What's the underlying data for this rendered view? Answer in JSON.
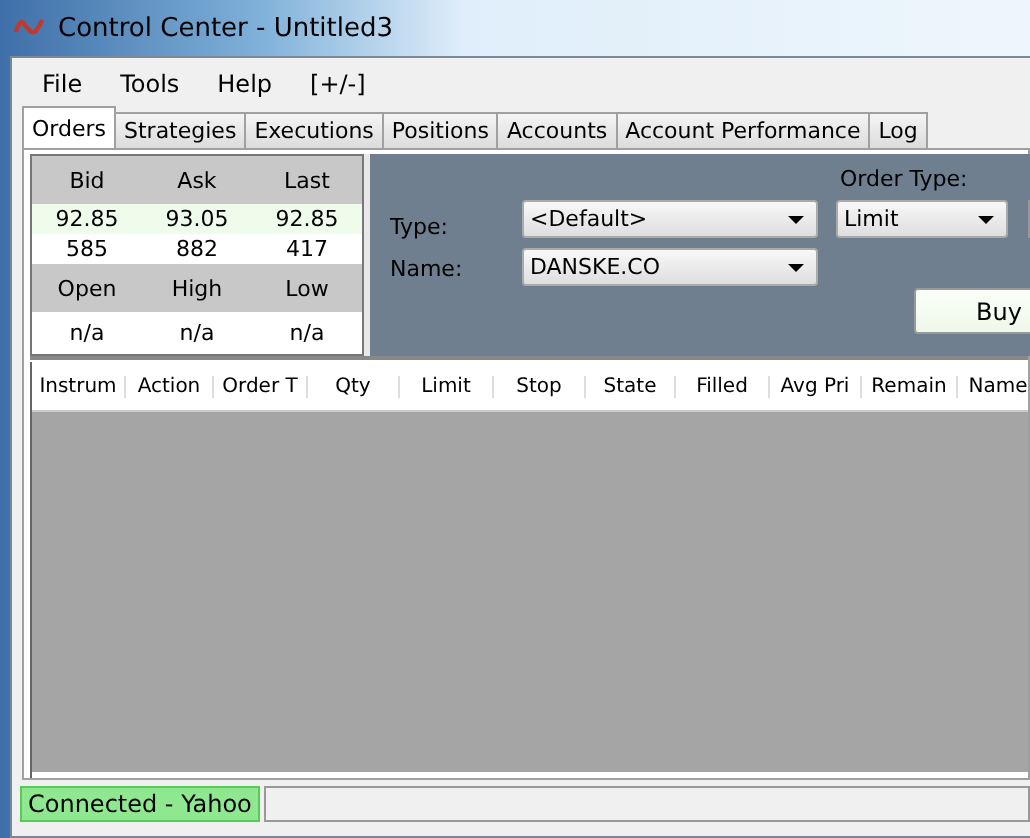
{
  "window": {
    "title": "Control Center - Untitled3"
  },
  "menu": [
    "File",
    "Tools",
    "Help",
    "[+/-]"
  ],
  "tabs": [
    {
      "label": "Orders",
      "selected": true
    },
    {
      "label": "Strategies",
      "selected": false
    },
    {
      "label": "Executions",
      "selected": false
    },
    {
      "label": "Positions",
      "selected": false
    },
    {
      "label": "Accounts",
      "selected": false
    },
    {
      "label": "Account Performance",
      "selected": false
    },
    {
      "label": "Log",
      "selected": false
    }
  ],
  "quote": {
    "headers": [
      "Bid",
      "Ask",
      "Last"
    ],
    "prices": [
      "92.85",
      "93.05",
      "92.85"
    ],
    "sizes": [
      "585",
      "882",
      "417"
    ],
    "stat_headers": [
      "Open",
      "High",
      "Low"
    ],
    "stats": [
      "n/a",
      "n/a",
      "n/a"
    ]
  },
  "order_form": {
    "type_label": "Type:",
    "type_value": "<Default>",
    "name_label": "Name:",
    "name_value": "DANSKE.CO",
    "order_type_label": "Order Type:",
    "order_type_value": "Limit",
    "buy_button": "Buy"
  },
  "table": {
    "columns": [
      "Instrum",
      "Action",
      "Order T",
      "Qty",
      "Limit",
      "Stop",
      "State",
      "Filled",
      "Avg Pri",
      "Remain",
      "Name"
    ]
  },
  "status_bar": {
    "connection": "Connected - Yahoo",
    "connected": true
  }
}
